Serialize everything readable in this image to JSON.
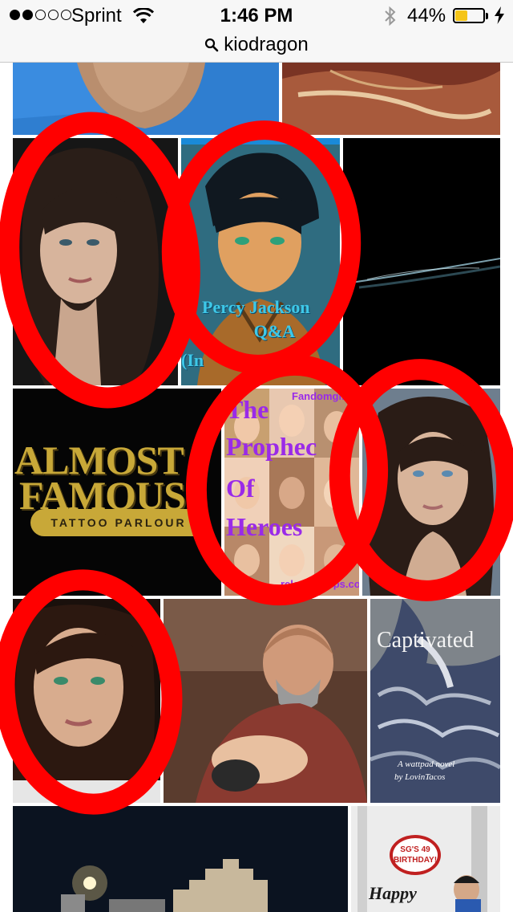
{
  "status_bar": {
    "signal_bars_filled": 2,
    "signal_bars_total": 5,
    "carrier": "Sprint",
    "time": "1:46 PM",
    "battery_percent": "44%",
    "battery_level": 0.44,
    "icons": [
      "wifi-icon",
      "bluetooth-icon",
      "battery-icon",
      "charging-bolt-icon"
    ]
  },
  "url_bar": {
    "query": "kiodragon",
    "icon": "search-icon"
  },
  "tiles": {
    "percy": {
      "title_1": "Percy Jackson",
      "title_2": "Q&A",
      "sub": "(In"
    },
    "almost_famous": {
      "line_1": "ALMOST",
      "line_2": "FAMOUS",
      "banner": "TATTOO PARLOUR"
    },
    "prophecy": {
      "tag": "Fandomgir",
      "line_1": "The",
      "line_2": "Prophec",
      "line_3": "Of",
      "line_4": "Heroes",
      "footer": "relationships.com"
    },
    "captivated": {
      "title": "Captivated",
      "sub_1": "A wattpad novel",
      "sub_2": "by LovinTacos"
    },
    "birthday": {
      "sign": "SG'S 49 BIRTHDAY!",
      "caption": "Happy"
    }
  },
  "colors": {
    "annotation_red": "#ff0000",
    "status_bg": "#f7f7f7",
    "battery_fill": "#f5c518"
  }
}
